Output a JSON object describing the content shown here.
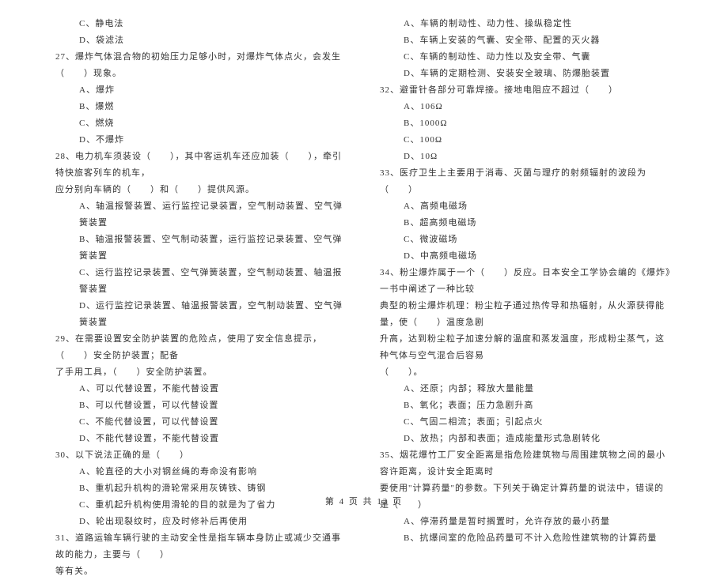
{
  "left_column": {
    "q26_opt_c": "C、静电法",
    "q26_opt_d": "D、袋滤法",
    "q27": "27、爆炸气体混合物的初始压力足够小时，对爆炸气体点火，会发生（　　）现象。",
    "q27_opt_a": "A、爆炸",
    "q27_opt_b": "B、爆燃",
    "q27_opt_c": "C、燃烧",
    "q27_opt_d": "D、不爆炸",
    "q28": "28、电力机车须装设（　　），其中客运机车还应加装（　　），牵引特快旅客列车的机车，",
    "q28_cont": "应分别向车辆的（　　）和（　　）提供风源。",
    "q28_opt_a": "A、轴温报警装置、运行监控记录装置，空气制动装置、空气弹簧装置",
    "q28_opt_b": "B、轴温报警装置、空气制动装置，运行监控记录装置、空气弹簧装置",
    "q28_opt_c": "C、运行监控记录装置、空气弹簧装置，空气制动装置、轴温报警装置",
    "q28_opt_d": "D、运行监控记录装置、轴温报警装置，空气制动装置、空气弹簧装置",
    "q29": "29、在需要设置安全防护装置的危险点，使用了安全信息提示，（　　）安全防护装置；配备",
    "q29_cont": "了手用工具，（　　）安全防护装置。",
    "q29_opt_a": "A、可以代替设置，不能代替设置",
    "q29_opt_b": "B、可以代替设置，可以代替设置",
    "q29_opt_c": "C、不能代替设置，可以代替设置",
    "q29_opt_d": "D、不能代替设置，不能代替设置",
    "q30": "30、以下说法正确的是（　　）",
    "q30_opt_a": "A、轮直径的大小对钢丝绳的寿命没有影响",
    "q30_opt_b": "B、重机起升机构的滑轮常采用灰铸铁、铸钢",
    "q30_opt_c": "C、重机起升机构使用滑轮的目的就是为了省力",
    "q30_opt_d": "D、轮出现裂纹时，应及时修补后再使用",
    "q31": "31、道路运输车辆行驶的主动安全性是指车辆本身防止或减少交通事故的能力，主要与（　　）",
    "q31_cont": "等有关。"
  },
  "right_column": {
    "q31_opt_a": "A、车辆的制动性、动力性、操纵稳定性",
    "q31_opt_b": "B、车辆上安装的气囊、安全带、配置的灭火器",
    "q31_opt_c": "C、车辆的制动性、动力性以及安全带、气囊",
    "q31_opt_d": "D、车辆的定期检测、安装安全玻璃、防爆胎装置",
    "q32": "32、避雷针各部分可靠焊接。接地电阻应不超过（　　）",
    "q32_opt_a": "A、106Ω",
    "q32_opt_b": "B、1000Ω",
    "q32_opt_c": "C、100Ω",
    "q32_opt_d": "D、10Ω",
    "q33": "33、医疗卫生上主要用于消毒、灭菌与理疗的射频辐射的波段为（　　）",
    "q33_opt_a": "A、高频电磁场",
    "q33_opt_b": "B、超高频电磁场",
    "q33_opt_c": "C、微波磁场",
    "q33_opt_d": "D、中高频电磁场",
    "q34": "34、粉尘爆炸属于一个（　　）反应。日本安全工学协会编的《爆炸》一书中阐述了一种比较",
    "q34_cont1": "典型的粉尘爆炸机理：粉尘粒子通过热传导和热辐射，从火源获得能量，使（　　）温度急剧",
    "q34_cont2": "升高，达到粉尘粒子加速分解的温度和蒸发温度，形成粉尘蒸气，这种气体与空气混合后容易",
    "q34_cont3": "（　　）。",
    "q34_opt_a": "A、还原；内部；释放大量能量",
    "q34_opt_b": "B、氧化；表面；压力急剧升高",
    "q34_opt_c": "C、气固二相流；表面；引起点火",
    "q34_opt_d": "D、放热；内部和表面；造成能量形式急剧转化",
    "q35": "35、烟花爆竹工厂安全距离是指危险建筑物与周围建筑物之间的最小容许距离，设计安全距离时",
    "q35_cont": "要使用\"计算药量\"的参数。下列关于确定计算药量的说法中，错误的是（　　）",
    "q35_opt_a": "A、停滞药量是暂时搁置时，允许存放的最小药量",
    "q35_opt_b": "B、抗爆间室的危险品药量可不计入危险性建筑物的计算药量"
  },
  "footer": "第 4 页 共 12 页"
}
